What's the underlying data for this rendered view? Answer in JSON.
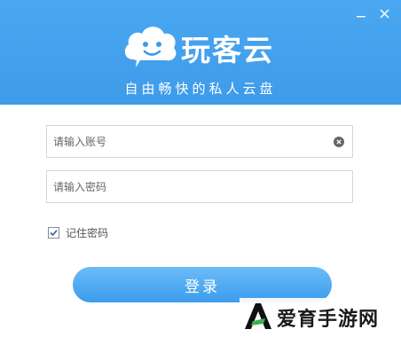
{
  "window": {
    "minimize_icon": "minimize-icon",
    "close_icon": "close-icon",
    "header_color": "#4aa7f1"
  },
  "brand": {
    "name": "玩客云",
    "slogan": "自由畅快的私人云盘",
    "logo_icon": "cloud-face-icon"
  },
  "login": {
    "username_placeholder": "请输入账号",
    "username_value": "",
    "password_placeholder": "请输入密码",
    "password_value": "",
    "clear_icon": "clear-icon",
    "remember_label": "记住密码",
    "remember_checked": true,
    "submit_label": "登录",
    "button_color": "#3c9cec"
  },
  "watermark": {
    "text": "爱育手游网",
    "logo_icon": "a-logo-icon"
  }
}
